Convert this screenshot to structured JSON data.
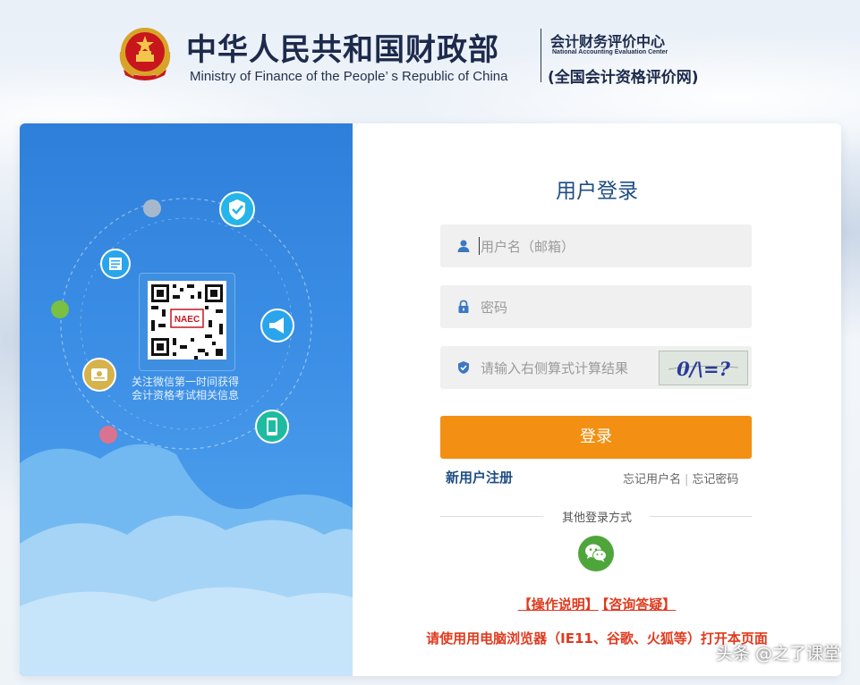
{
  "header": {
    "title_cn": "中华人民共和国财政部",
    "title_en": "Ministry of Finance of the People’ s Republic of China",
    "center_cn": "会计财务评价中心",
    "center_en": "National Accounting Evaluation Center",
    "center_sub": "(全国会计资格评价网)"
  },
  "promo": {
    "qr_badge": "NAEC",
    "caption_line1": "关注微信第一时间获得",
    "caption_line2": "会计资格考试相关信息"
  },
  "login": {
    "title": "用户登录",
    "username_placeholder": "用户名（邮箱）",
    "password_placeholder": "密码",
    "captcha_placeholder": "请输入右侧算式计算结果",
    "captcha_text": "0/\\=?",
    "submit_label": "登录",
    "register_label": "新用户注册",
    "forgot_username": "忘记用户名",
    "separator": "|",
    "forgot_password": "忘记密码",
    "other_methods": "其他登录方式",
    "operation_guide": "【操作说明】",
    "consult": "【咨询答疑】",
    "browser_notice": "请使用用电脑浏览器（IE11、谷歌、火狐等）打开本页面"
  },
  "watermark": "头条 @之了课堂",
  "colors": {
    "accent_blue": "#1e4e84",
    "login_button": "#f39013",
    "notice_red": "#e03a1e",
    "wechat_green": "#4ea63b",
    "panel_blue": "#2e7fda"
  },
  "icons": [
    "national-emblem-icon",
    "user-icon",
    "lock-icon",
    "shield-icon",
    "wechat-icon",
    "shield-check-icon",
    "document-icon",
    "megaphone-icon",
    "certificate-icon",
    "mobile-phone-icon",
    "qr-code"
  ]
}
